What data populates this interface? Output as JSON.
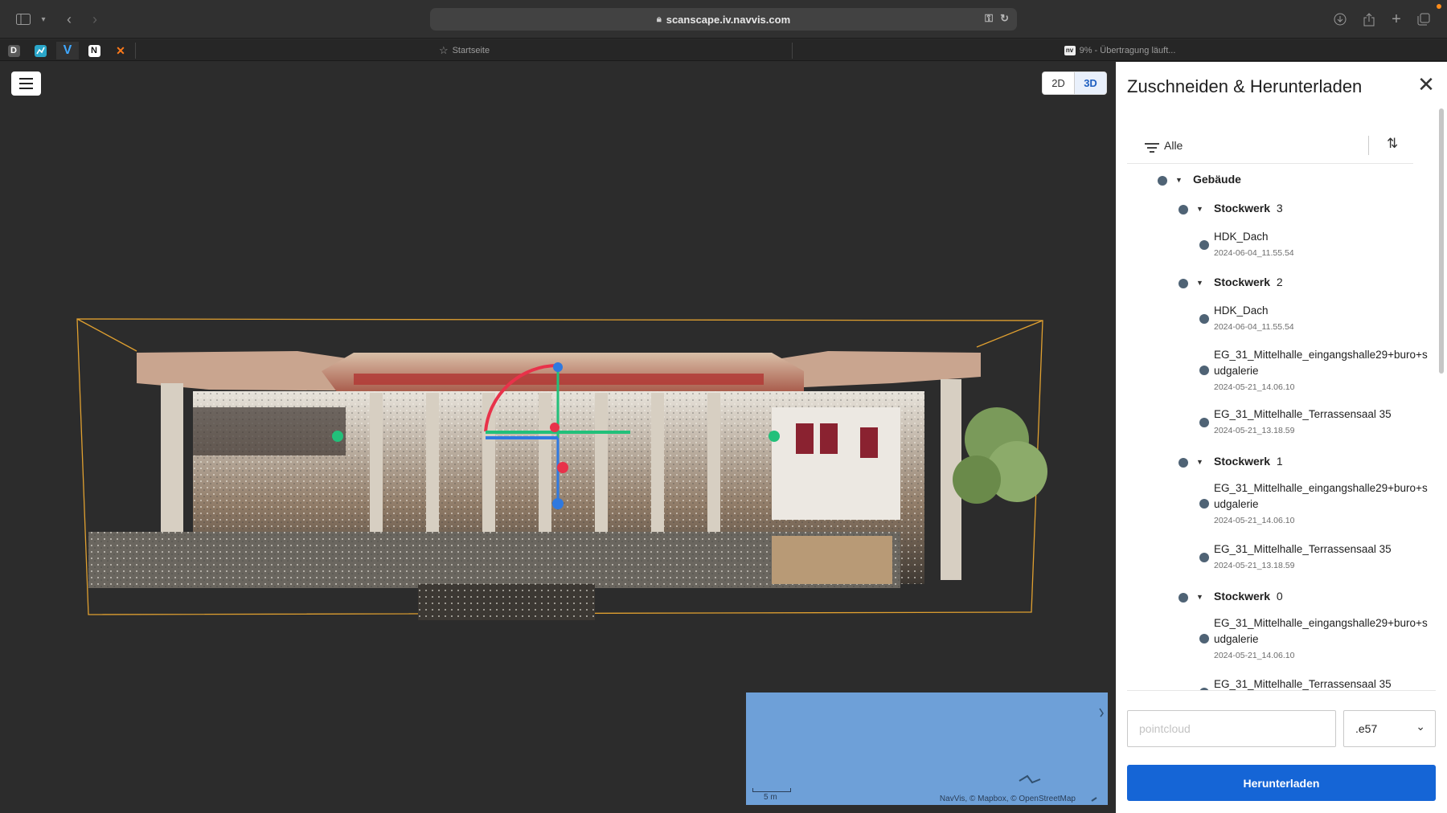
{
  "browser": {
    "url": "scanscape.iv.navvis.com",
    "tabs": [
      {
        "label": "Startseite",
        "icon": "star-icon"
      },
      {
        "label": "9% - Übertragung läuft...",
        "icon": "navvis-icon"
      }
    ],
    "pinned_tabs": [
      {
        "letter": "D",
        "bg": "#5a5a5a",
        "fg": "#ffffff"
      },
      {
        "letter": "",
        "bg": "#2aa6c9",
        "fg": "#ffffff"
      },
      {
        "letter": "V",
        "bg": "transparent",
        "fg": "#3fa8ff"
      },
      {
        "letter": "N",
        "bg": "#ffffff",
        "fg": "#111111"
      },
      {
        "letter": "✕",
        "bg": "transparent",
        "fg": "#ff7a1a"
      }
    ]
  },
  "viewer": {
    "mode_2d": "2D",
    "mode_3d": "3D",
    "active_mode": "3D",
    "map_attribution": "NavVis, © Mapbox, © OpenStreetMap",
    "map_scale": "5 m"
  },
  "panel": {
    "title": "Zuschneiden & Herunterladen",
    "filter_label": "Alle",
    "root": "Gebäude",
    "floor_prefix": "Stockwerk",
    "floors": [
      {
        "number": "3",
        "items": [
          {
            "name": "HDK_Dach",
            "date": "2024-06-04_11.55.54"
          }
        ]
      },
      {
        "number": "2",
        "items": [
          {
            "name": "HDK_Dach",
            "date": "2024-06-04_11.55.54"
          },
          {
            "name": "EG_31_Mittelhalle_eingangshalle29+buro+sudgalerie",
            "date": "2024-05-21_14.06.10"
          },
          {
            "name": "EG_31_Mittelhalle_Terrassensaal 35",
            "date": "2024-05-21_13.18.59"
          }
        ]
      },
      {
        "number": "1",
        "items": [
          {
            "name": "EG_31_Mittelhalle_eingangshalle29+buro+sudgalerie",
            "date": "2024-05-21_14.06.10"
          },
          {
            "name": "EG_31_Mittelhalle_Terrassensaal 35",
            "date": "2024-05-21_13.18.59"
          }
        ]
      },
      {
        "number": "0",
        "items": [
          {
            "name": "EG_31_Mittelhalle_eingangshalle29+buro+sudgalerie",
            "date": "2024-05-21_14.06.10"
          },
          {
            "name": "EG_31_Mittelhalle_Terrassensaal 35",
            "date": ""
          }
        ]
      }
    ],
    "name_placeholder": "pointcloud",
    "format_value": ".e57",
    "download_label": "Herunterladen"
  }
}
